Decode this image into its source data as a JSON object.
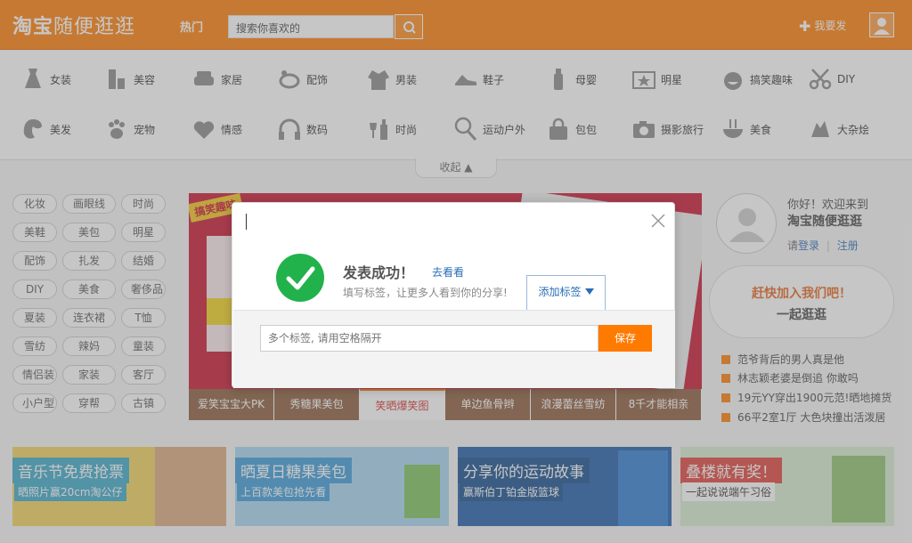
{
  "header": {
    "logo_bold": "淘宝",
    "logo_rest": "随便逛逛",
    "hot_label": "热门",
    "search_placeholder": "搜索你喜欢的",
    "post_label": "我要发"
  },
  "categories": [
    {
      "label": "女装",
      "icon": "dress-icon"
    },
    {
      "label": "美容",
      "icon": "cosmetics-icon"
    },
    {
      "label": "家居",
      "icon": "sofa-icon"
    },
    {
      "label": "配饰",
      "icon": "accessory-icon"
    },
    {
      "label": "男装",
      "icon": "jacket-icon"
    },
    {
      "label": "鞋子",
      "icon": "shoe-icon"
    },
    {
      "label": "母婴",
      "icon": "baby-bottle-icon"
    },
    {
      "label": "明星",
      "icon": "star-tv-icon"
    },
    {
      "label": "搞笑趣味",
      "icon": "funny-face-icon"
    },
    {
      "label": "DIY",
      "icon": "scissors-icon"
    },
    {
      "label": "美发",
      "icon": "hair-icon"
    },
    {
      "label": "宠物",
      "icon": "paw-icon"
    },
    {
      "label": "情感",
      "icon": "heart-icon"
    },
    {
      "label": "数码",
      "icon": "headphones-icon"
    },
    {
      "label": "时尚",
      "icon": "wine-icon"
    },
    {
      "label": "运动户外",
      "icon": "racket-icon"
    },
    {
      "label": "包包",
      "icon": "bag-icon"
    },
    {
      "label": "摄影旅行",
      "icon": "camera-icon"
    },
    {
      "label": "美食",
      "icon": "noodle-bowl-icon"
    },
    {
      "label": "大杂烩",
      "icon": "misc-icon"
    }
  ],
  "collapse_label": "收起",
  "tags": [
    "化妆",
    "画眼线",
    "时尚",
    "美鞋",
    "美包",
    "明星",
    "配饰",
    "扎发",
    "结婚",
    "DIY",
    "美食",
    "奢侈品",
    "夏装",
    "连衣裙",
    "T恤",
    "雪纺",
    "辣妈",
    "童装",
    "情侣装",
    "家装",
    "客厅",
    "小户型",
    "穿帮",
    "古镇"
  ],
  "banner": {
    "badge": "搞笑趣味",
    "thumbs": [
      "爱笑宝宝大PK",
      "秀糖果美包",
      "笑晒爆笑图",
      "单边鱼骨辫",
      "浪漫蕾丝雪纺",
      "8千才能相亲"
    ]
  },
  "right_panel": {
    "hello": "你好！欢迎来到",
    "site": "淘宝随便逛逛",
    "login_prefix": "请",
    "login": "登录",
    "divider": "|",
    "register": "注册",
    "join_line1": "赶快加入我们吧！",
    "join_line2": "一起逛逛",
    "news": [
      "范爷背后的男人真是他",
      "林志颖老婆是倒追 你敢吗",
      "19元YY穿出1900元范!晒地摊货",
      "66平2室1厅 大色块撞出活泼居"
    ]
  },
  "promos": [
    {
      "title": "音乐节免费抢票",
      "sub": "晒照片赢20cm淘公仔"
    },
    {
      "title": "晒夏日糖果美包",
      "sub": "上百款美包抢先看"
    },
    {
      "title": "分享你的运动故事",
      "sub": "赢斯伯丁铂金版篮球"
    },
    {
      "title": "叠楼就有奖！",
      "sub": "一起说说端午习俗"
    }
  ],
  "modal": {
    "success_title": "发表成功！",
    "view_link": "去看看",
    "hint": "填写标签，让更多人看到你的分享!",
    "add_tag": "添加标签",
    "tag_input_placeholder": "多个标签, 请用空格隔开",
    "save_label": "保存"
  },
  "colors": {
    "brand": "#ff7a00",
    "link": "#2a6eb5",
    "success": "#22b24c"
  }
}
